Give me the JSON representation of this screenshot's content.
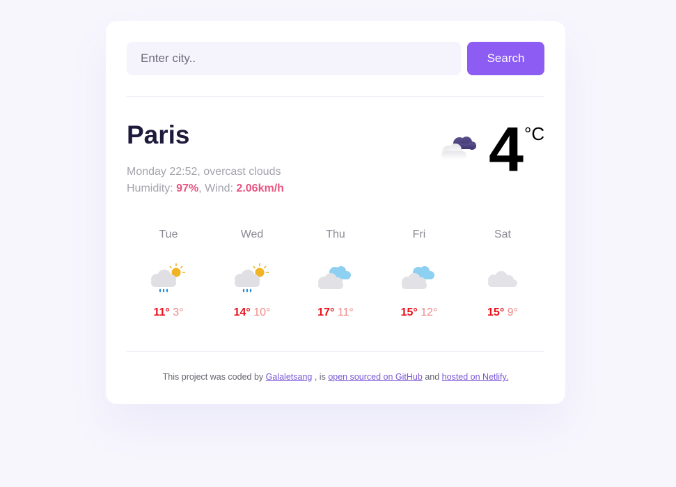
{
  "search": {
    "placeholder": "Enter city..",
    "button_label": "Search"
  },
  "current": {
    "city": "Paris",
    "description": "Monday 22:52, overcast clouds",
    "humidity_label": "Humidity:",
    "humidity_value": "97%",
    "wind_label": ", Wind:",
    "wind_value": "2.06km/h",
    "temperature": "4",
    "unit": "°C",
    "icon": "overcast-clouds-icon"
  },
  "forecast": [
    {
      "day": "Tue",
      "max": "11°",
      "min": "3°",
      "icon": "rain-sun-icon"
    },
    {
      "day": "Wed",
      "max": "14°",
      "min": "10°",
      "icon": "rain-sun-icon"
    },
    {
      "day": "Thu",
      "max": "17°",
      "min": "11°",
      "icon": "broken-clouds-icon"
    },
    {
      "day": "Fri",
      "max": "15°",
      "min": "12°",
      "icon": "broken-clouds-icon"
    },
    {
      "day": "Sat",
      "max": "15°",
      "min": "9°",
      "icon": "cloud-icon"
    }
  ],
  "footer": {
    "text_1": "This project was coded by",
    "author_link": "Galaletsang",
    "text_2": ", is",
    "github_link": "open sourced on GitHub",
    "text_3": "and",
    "netlify_link": "hosted on Netlify."
  },
  "colors": {
    "accent": "#8c5cf3",
    "highlight": "#e9557f",
    "temp_max": "#e8101a",
    "temp_min": "#f08a8a"
  }
}
